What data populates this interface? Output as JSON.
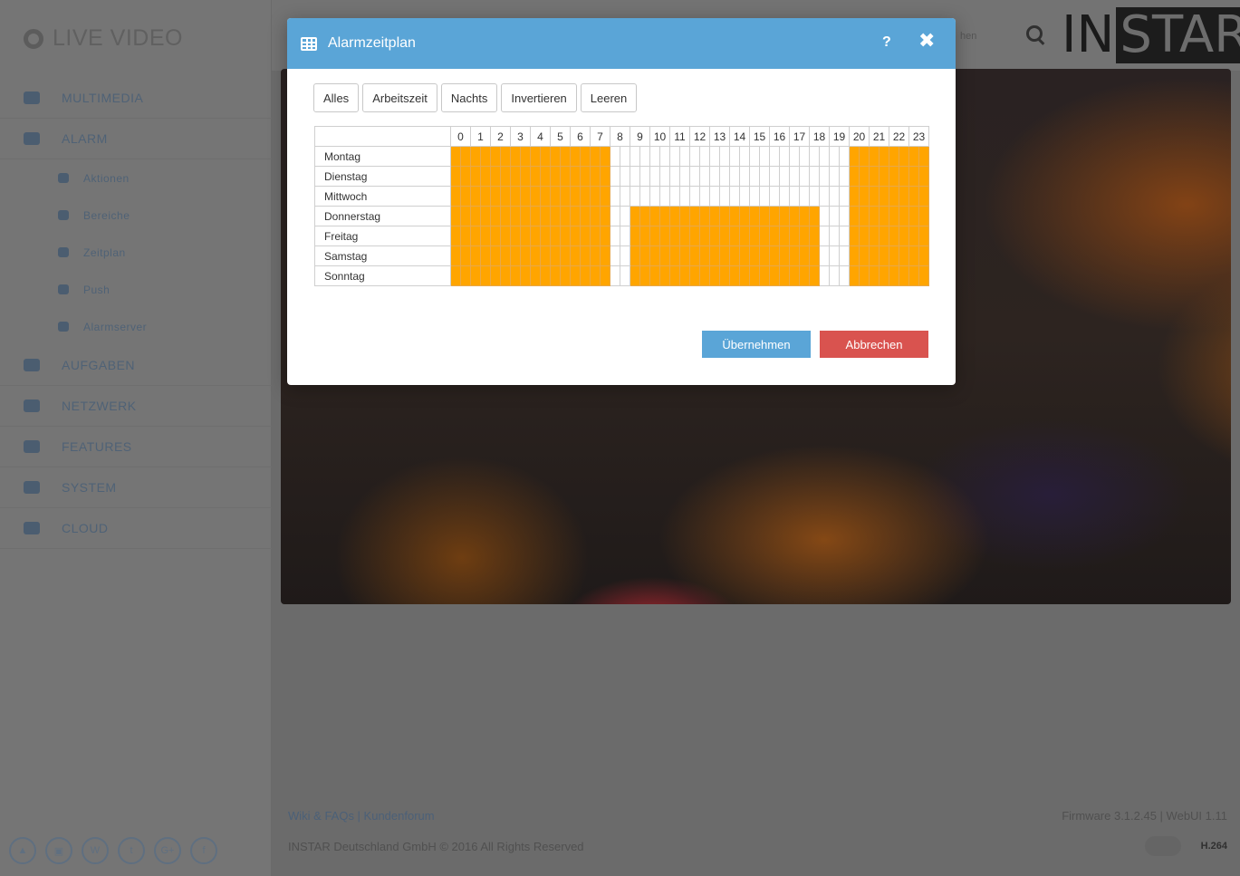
{
  "app": {
    "brand": "LIVE VIDEO",
    "logo_in": "IN",
    "logo_star": "STAR",
    "topbar_fragment": "hen"
  },
  "sidebar": {
    "items": [
      {
        "label": "MULTIMEDIA",
        "level": "main",
        "icon": "image-icon"
      },
      {
        "label": "ALARM",
        "level": "main",
        "icon": "bell-icon"
      },
      {
        "label": "Aktionen",
        "level": "sub",
        "icon": "bell-icon"
      },
      {
        "label": "Bereiche",
        "level": "sub",
        "icon": "grid-icon"
      },
      {
        "label": "Zeitplan",
        "level": "sub",
        "icon": "table-icon"
      },
      {
        "label": "Push",
        "level": "sub",
        "icon": "push-icon"
      },
      {
        "label": "Alarmserver",
        "level": "sub",
        "icon": "table-icon"
      },
      {
        "label": "AUFGABEN",
        "level": "main",
        "icon": "film-icon"
      },
      {
        "label": "NETZWERK",
        "level": "main",
        "icon": "network-icon"
      },
      {
        "label": "FEATURES",
        "level": "main",
        "icon": "star-icon"
      },
      {
        "label": "SYSTEM",
        "level": "main",
        "icon": "gear-icon"
      },
      {
        "label": "CLOUD",
        "level": "main",
        "icon": "cloud-icon"
      }
    ],
    "socials": [
      "▲",
      "▣",
      "W",
      "t",
      "G+",
      "f"
    ]
  },
  "footer": {
    "links": "Wiki & FAQs | Kundenforum",
    "copyright": "INSTAR Deutschland GmbH © 2016 All Rights Reserved",
    "firmware": "Firmware 3.1.2.45 | WebUI 1.11",
    "codec": "H.264"
  },
  "modal": {
    "title": "Alarmzeitplan",
    "help": "?",
    "close": "✖",
    "presets": [
      "Alles",
      "Arbeitszeit",
      "Nachts",
      "Invertieren",
      "Leeren"
    ],
    "hours": [
      "0",
      "1",
      "2",
      "3",
      "4",
      "5",
      "6",
      "7",
      "8",
      "9",
      "10",
      "11",
      "12",
      "13",
      "14",
      "15",
      "16",
      "17",
      "18",
      "19",
      "20",
      "21",
      "22",
      "23"
    ],
    "schedule": [
      {
        "day": "Montag",
        "active_half_hours": [
          [
            0,
            15
          ],
          [
            40,
            47
          ]
        ]
      },
      {
        "day": "Dienstag",
        "active_half_hours": [
          [
            0,
            15
          ],
          [
            40,
            47
          ]
        ]
      },
      {
        "day": "Mittwoch",
        "active_half_hours": [
          [
            0,
            15
          ],
          [
            40,
            47
          ]
        ]
      },
      {
        "day": "Donnerstag",
        "active_half_hours": [
          [
            0,
            15
          ],
          [
            18,
            36
          ],
          [
            40,
            47
          ]
        ]
      },
      {
        "day": "Freitag",
        "active_half_hours": [
          [
            0,
            15
          ],
          [
            18,
            36
          ],
          [
            40,
            47
          ]
        ]
      },
      {
        "day": "Samstag",
        "active_half_hours": [
          [
            0,
            15
          ],
          [
            18,
            36
          ],
          [
            40,
            47
          ]
        ]
      },
      {
        "day": "Sonntag",
        "active_half_hours": [
          [
            0,
            15
          ],
          [
            18,
            36
          ],
          [
            40,
            47
          ]
        ]
      }
    ],
    "active_color": "#ffa500",
    "apply_label": "Übernehmen",
    "cancel_label": "Abbrechen"
  }
}
